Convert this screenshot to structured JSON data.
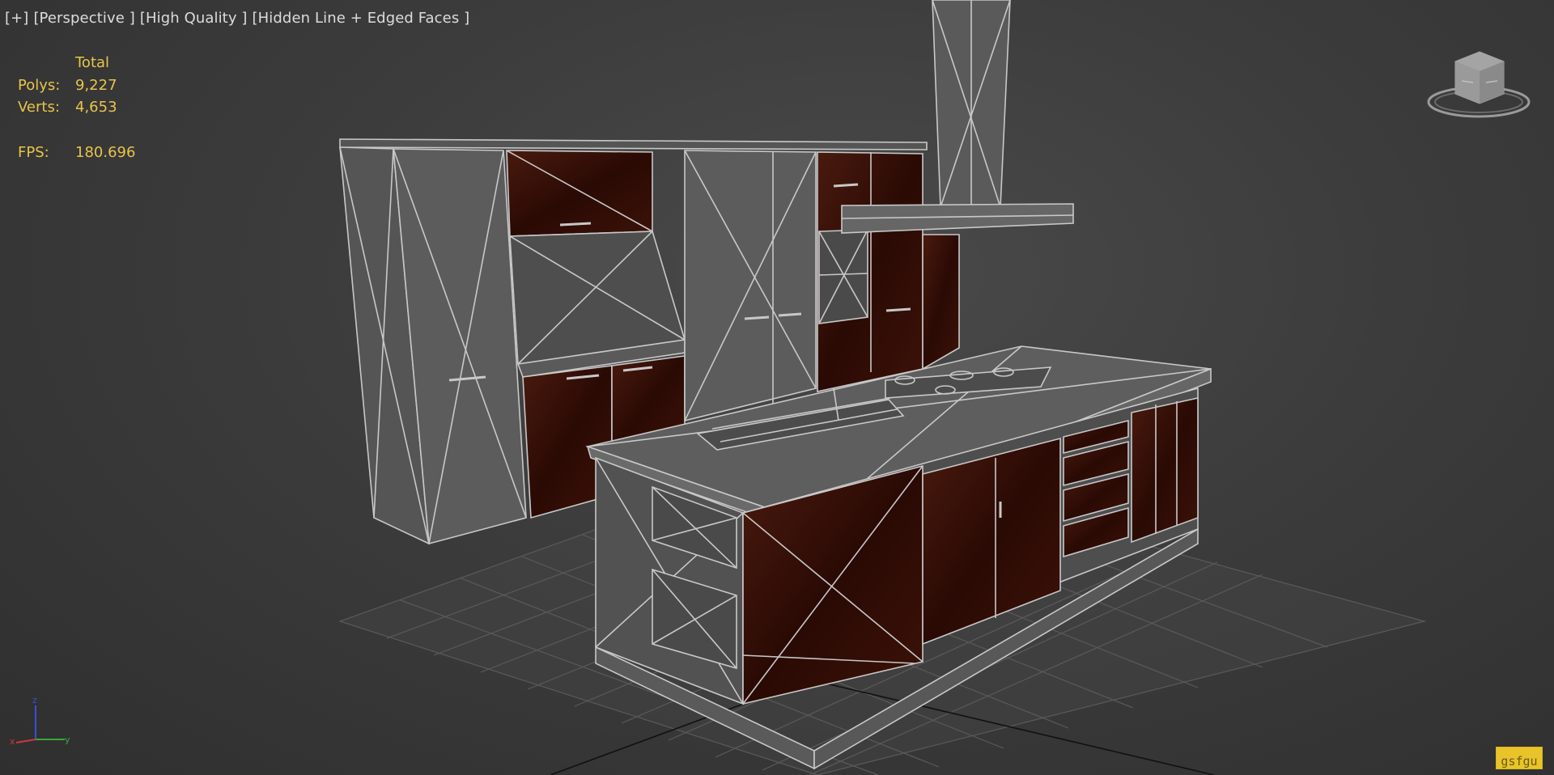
{
  "viewport": {
    "menu": {
      "plus": "[+]",
      "view": "[Perspective ]",
      "quality": "[High Quality ]",
      "shading": "[Hidden Line + Edged Faces ]"
    },
    "stats": {
      "header": "Total",
      "polys_label": "Polys:",
      "polys_value": "9,227",
      "verts_label": "Verts:",
      "verts_value": "4,653",
      "fps_label": "FPS:",
      "fps_value": "180.696"
    },
    "corner_label": "gsfgu",
    "colors": {
      "stats_text": "#e8c44a",
      "wire": "#c8c8c8",
      "wood": "#3a1208",
      "background": "#3c3c3c"
    }
  }
}
